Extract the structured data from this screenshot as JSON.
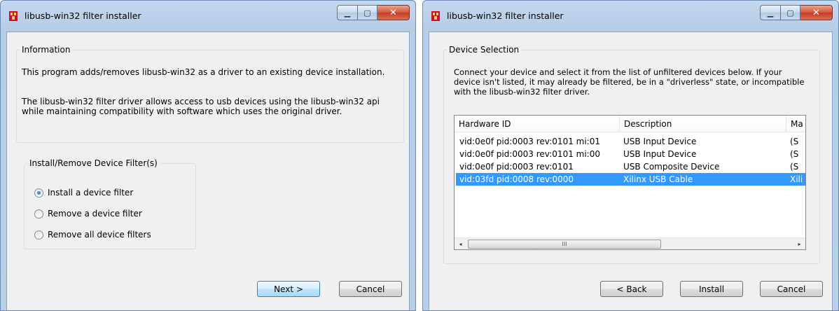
{
  "left_window": {
    "title": "libusb-win32 filter installer",
    "info_group": {
      "legend": "Information",
      "paragraph1": "This program adds/removes libusb-win32 as a driver to an existing device installation.",
      "paragraph2": "The libusb-win32 filter driver allows access to usb devices using the libusb-win32 api while maintaining compatibility with software which uses the original driver."
    },
    "filter_group": {
      "legend": "Install/Remove Device Filter(s)",
      "options": [
        {
          "label": "Install a device filter",
          "checked": true
        },
        {
          "label": "Remove a device filter",
          "checked": false
        },
        {
          "label": "Remove all device filters",
          "checked": false
        }
      ]
    },
    "buttons": {
      "next": "Next >",
      "cancel": "Cancel"
    }
  },
  "right_window": {
    "title": "libusb-win32 filter installer",
    "selection_group": {
      "legend": "Device Selection",
      "paragraph": "Connect your device and select it from the list of unfiltered devices below. If your device isn't listed, it may already be filtered, be in a \"driverless\" state, or incompatible with the libusb-win32 filter driver."
    },
    "device_list": {
      "columns": [
        "Hardware ID",
        "Description",
        "Ma"
      ],
      "rows": [
        {
          "hardware_id": "vid:0e0f pid:0003 rev:0101 mi:01",
          "description": "USB Input Device",
          "manufacturer": "(S",
          "selected": false
        },
        {
          "hardware_id": "vid:0e0f pid:0003 rev:0101 mi:00",
          "description": "USB Input Device",
          "manufacturer": "(S",
          "selected": false
        },
        {
          "hardware_id": "vid:0e0f pid:0003 rev:0101",
          "description": "USB Composite Device",
          "manufacturer": "(S",
          "selected": false
        },
        {
          "hardware_id": "vid:03fd pid:0008 rev:0000",
          "description": "Xilinx USB Cable",
          "manufacturer": "Xili",
          "selected": true
        }
      ],
      "scroll_left_glyph": "◂",
      "scroll_thumb_glyph": "III",
      "scroll_right_glyph": "▸"
    },
    "buttons": {
      "back": "< Back",
      "install": "Install",
      "cancel": "Cancel"
    }
  },
  "window_controls": {
    "minimize": "▁",
    "maximize": "▢",
    "close": "✕"
  },
  "colors": {
    "selection": "#3399ff",
    "close_button": "#c33a20",
    "titlebar": "#b9cfe8"
  }
}
